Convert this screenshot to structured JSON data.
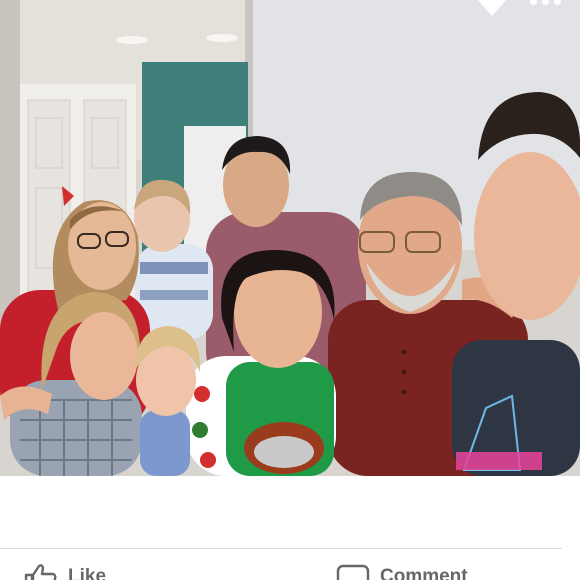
{
  "post": {
    "photo": {
      "alt": ""
    },
    "actions": {
      "like_label": "Like",
      "comment_label": "Comment"
    }
  },
  "icons": {
    "chevron": "chevron-down-icon",
    "more": "more-options-icon",
    "like": "thumbs-up-icon",
    "comment": "comment-icon"
  },
  "colors": {
    "action_text": "#65676b",
    "divider": "#d9dadc",
    "background": "#ffffff"
  }
}
